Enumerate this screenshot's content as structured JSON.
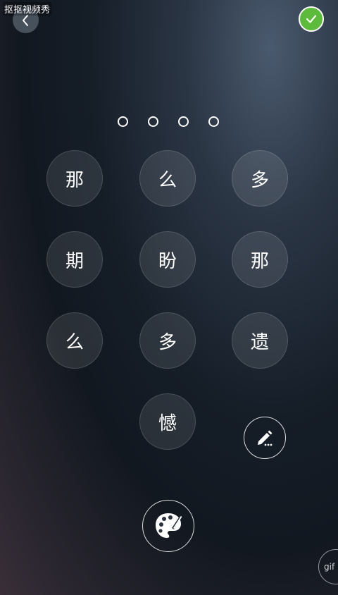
{
  "watermark": "抠抠视频秀",
  "nav": {
    "back_icon": "chevron-left-icon",
    "confirm_icon": "check-circle-icon",
    "confirm_color": "#5dbb3b"
  },
  "pin_indicator": {
    "total": 4,
    "filled": 0
  },
  "keypad": {
    "keys": [
      "那",
      "么",
      "多",
      "期",
      "盼",
      "那",
      "么",
      "多",
      "遗",
      "憾"
    ]
  },
  "tools": {
    "edit_icon": "pencil-icon",
    "palette_icon": "palette-icon",
    "gif_label": "gif"
  }
}
